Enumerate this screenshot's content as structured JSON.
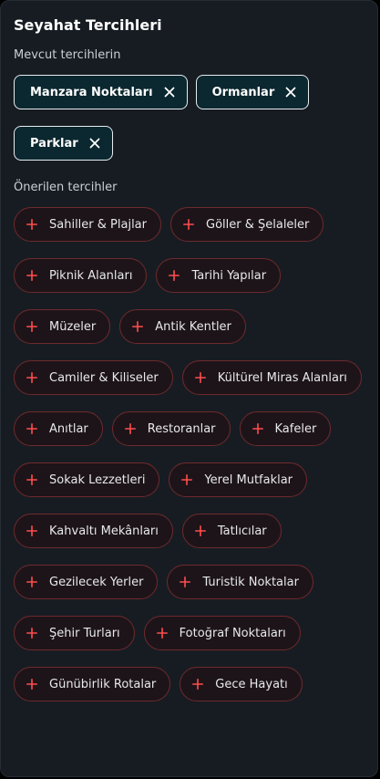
{
  "panel": {
    "title": "Seyahat Tercihleri",
    "current_label": "Mevcut tercihlerin",
    "suggested_label": "Önerilen tercihler"
  },
  "selected": [
    {
      "label": "Manzara Noktaları",
      "icon": "close-icon"
    },
    {
      "label": "Ormanlar",
      "icon": "close-icon"
    },
    {
      "label": "Parklar",
      "icon": "close-icon"
    }
  ],
  "suggested": [
    {
      "label": "Sahiller & Plajlar"
    },
    {
      "label": "Göller & Şelaleler"
    },
    {
      "label": "Piknik Alanları"
    },
    {
      "label": "Tarihi Yapılar"
    },
    {
      "label": "Müzeler"
    },
    {
      "label": "Antik Kentler"
    },
    {
      "label": "Camiler & Kiliseler"
    },
    {
      "label": "Kültürel Miras Alanları"
    },
    {
      "label": "Anıtlar"
    },
    {
      "label": "Restoranlar"
    },
    {
      "label": "Kafeler"
    },
    {
      "label": "Sokak Lezzetleri"
    },
    {
      "label": "Yerel Mutfaklar"
    },
    {
      "label": "Kahvaltı Mekânları"
    },
    {
      "label": "Tatlıcılar"
    },
    {
      "label": "Gezilecek Yerler"
    },
    {
      "label": "Turistik Noktalar"
    },
    {
      "label": "Şehir Turları"
    },
    {
      "label": "Fotoğraf Noktaları"
    },
    {
      "label": "Günübirlik Rotalar"
    },
    {
      "label": "Gece Hayatı"
    }
  ],
  "colors": {
    "background": "#171c22",
    "selected_chip_bg": "#0b2730",
    "selected_chip_border": "#e7ecef",
    "suggested_chip_border": "#6e2a2d",
    "accent_plus": "#ff4d4d"
  }
}
